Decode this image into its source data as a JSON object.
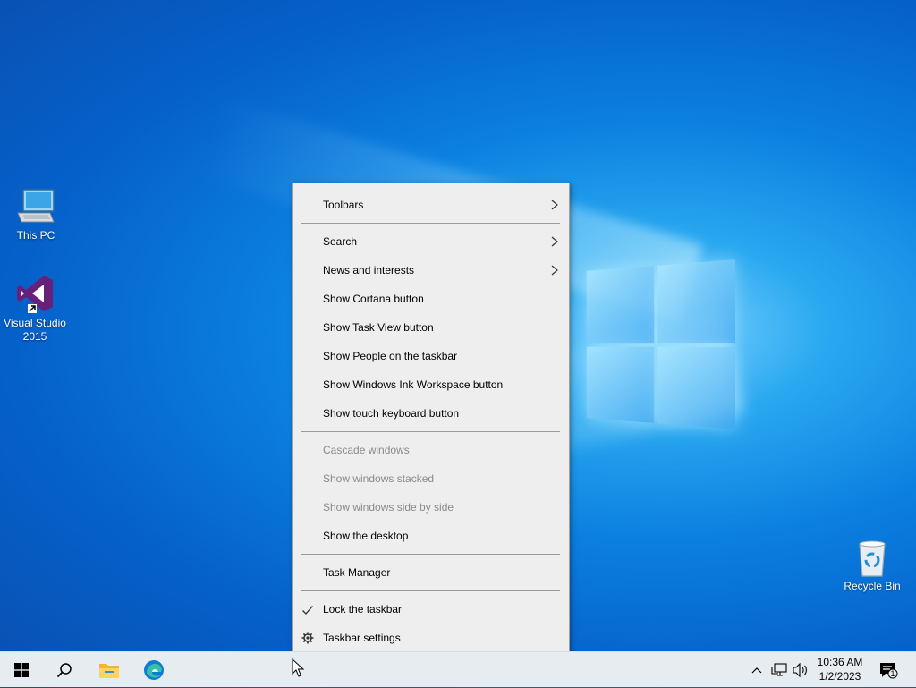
{
  "desktop": {
    "icons": [
      {
        "label": "This PC"
      },
      {
        "label": "Visual Studio 2015"
      },
      {
        "label": "Recycle Bin"
      }
    ]
  },
  "context_menu": {
    "items": {
      "toolbars": "Toolbars",
      "search": "Search",
      "news": "News and interests",
      "cortana": "Show Cortana button",
      "task_view": "Show Task View button",
      "people": "Show People on the taskbar",
      "ink": "Show Windows Ink Workspace button",
      "touch_keyboard": "Show touch keyboard button",
      "cascade": "Cascade windows",
      "stacked": "Show windows stacked",
      "side_by_side": "Show windows side by side",
      "show_desktop": "Show the desktop",
      "task_manager": "Task Manager",
      "lock": "Lock the taskbar",
      "settings": "Taskbar settings"
    }
  },
  "taskbar": {
    "clock": {
      "time": "10:36 AM",
      "date": "1/2/2023"
    },
    "notifications_count": "1"
  },
  "colors": {
    "menu_bg": "#eeeeee",
    "disabled_text": "#8a8a8a",
    "taskbar_bg": "#e7ecf1",
    "accent": "#0b7fe0"
  }
}
